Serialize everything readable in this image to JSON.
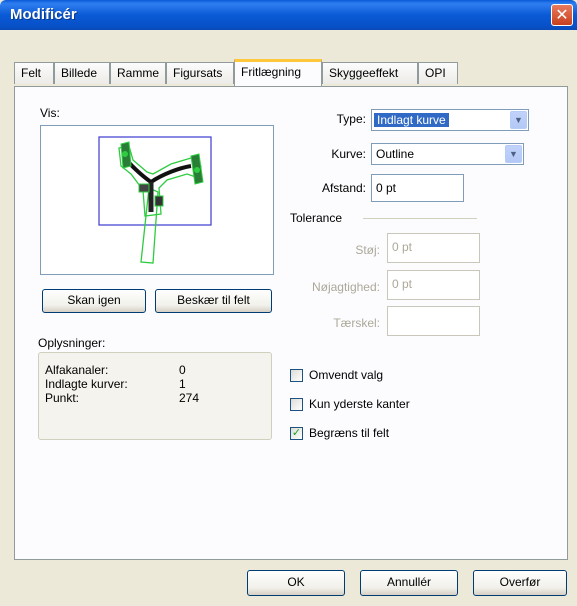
{
  "window": {
    "title": "Modificér"
  },
  "tabs": [
    {
      "label": "Felt"
    },
    {
      "label": "Billede"
    },
    {
      "label": "Ramme"
    },
    {
      "label": "Figursats"
    },
    {
      "label": "Fritlægning"
    },
    {
      "label": "Skyggeeffekt"
    },
    {
      "label": "OPI"
    }
  ],
  "active_tab": "Fritlægning",
  "preview": {
    "label": "Vis:"
  },
  "buttons": {
    "rescan": "Skan igen",
    "crop_to_box": "Beskær til felt",
    "ok": "OK",
    "cancel": "Annullér",
    "apply": "Overfør"
  },
  "info": {
    "label": "Oplysninger:",
    "rows": [
      {
        "key": "Alfakanaler:",
        "value": "0"
      },
      {
        "key": "Indlagte kurver:",
        "value": "1"
      },
      {
        "key": "Punkt:",
        "value": "274"
      }
    ]
  },
  "type": {
    "label": "Type:",
    "value": "Indlagt kurve"
  },
  "curve": {
    "label": "Kurve:",
    "value": "Outline"
  },
  "distance": {
    "label": "Afstand:",
    "value": "0 pt"
  },
  "tolerance": {
    "label": "Tolerance",
    "noise": {
      "label": "Støj:",
      "value": "0 pt"
    },
    "smoothness": {
      "label": "Nøjagtighed:",
      "value": "0 pt"
    },
    "threshold": {
      "label": "Tærskel:",
      "value": ""
    }
  },
  "checkboxes": [
    {
      "label": "Omvendt valg",
      "checked": false
    },
    {
      "label": "Kun yderste kanter",
      "checked": false
    },
    {
      "label": "Begræns til felt",
      "checked": true
    }
  ],
  "colors": {
    "title_bar": "#0a5ad8",
    "selection": "#316ac5",
    "active_tab_accent": "#ffc83c",
    "clip_path": "#2ecc40",
    "box_outline": "#3b3bd1"
  }
}
